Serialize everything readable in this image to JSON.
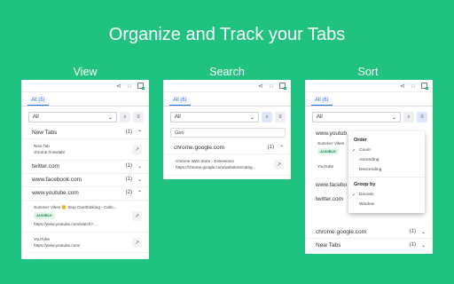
{
  "title": "Organize and Track your Tabs",
  "labels": [
    "View",
    "Search",
    "Sort"
  ],
  "toolbar_icons": [
    "share-icon",
    "star-icon",
    "extension-icon"
  ],
  "view_panel": {
    "tab": "All (5)",
    "select": "All",
    "groups": [
      {
        "name": "New Tabs",
        "count": "(1)",
        "expanded": true,
        "items": [
          {
            "title": "New Tab",
            "url": "chrome://newtab/"
          }
        ]
      },
      {
        "name": "twitter.com",
        "count": "(1)",
        "expanded": false
      },
      {
        "name": "www.facebook.com",
        "count": "(1)",
        "expanded": false
      },
      {
        "name": "www.youtube.com",
        "count": "(2)",
        "expanded": true,
        "items": [
          {
            "title": "Summer Vibes 😊 Stop Overthinking - Calm...",
            "url": "https://www.youtube.com/watch?...",
            "badge": "AUDIBLE"
          },
          {
            "title": "YouTube",
            "url": "https://www.youtube.com/"
          }
        ]
      }
    ]
  },
  "search_panel": {
    "tab": "All (6)",
    "select": "All",
    "query": "Goo",
    "groups": [
      {
        "name": "chrome.google.com",
        "count": "(1)",
        "expanded": true,
        "items": [
          {
            "title": "Chrome Web Store - Extensions",
            "url": "https://chrome.google.com/webstore/categ..."
          }
        ]
      }
    ]
  },
  "sort_panel": {
    "tab": "All (6)",
    "select": "All",
    "bg_groups": [
      {
        "name": "www.youtub",
        "partial": true
      },
      {
        "name": "Summer Vibes",
        "sub": true,
        "badge": "AUDIBLE"
      },
      {
        "name": "YouTube",
        "sub": true
      },
      {
        "name": "www.facebo",
        "partial": true
      },
      {
        "name": "twitter.com",
        "partial": true
      }
    ],
    "groups": [
      {
        "name": "chrome.google.com",
        "count": "(1)"
      },
      {
        "name": "New Tabs",
        "count": "(1)"
      }
    ],
    "dropdown": {
      "order_title": "Order",
      "order_items": [
        {
          "label": "Count",
          "checked": true
        },
        {
          "label": "Ascending",
          "checked": false
        },
        {
          "label": "Descending",
          "checked": false
        }
      ],
      "group_title": "Group by",
      "group_items": [
        {
          "label": "Domain",
          "checked": true
        },
        {
          "label": "Window",
          "checked": false
        }
      ]
    }
  },
  "accent_color": "#1fc37f",
  "link_color": "#1a73e8"
}
